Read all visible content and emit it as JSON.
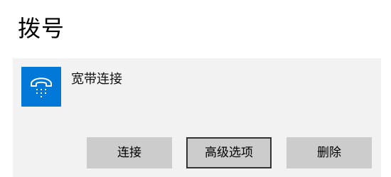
{
  "page": {
    "title": "拨号"
  },
  "connection": {
    "name": "宽带连接",
    "icon": "dialup-phone-icon",
    "tile_color": "#0078d7"
  },
  "buttons": {
    "connect_label": "连接",
    "advanced_label": "高级选项",
    "delete_label": "删除"
  }
}
